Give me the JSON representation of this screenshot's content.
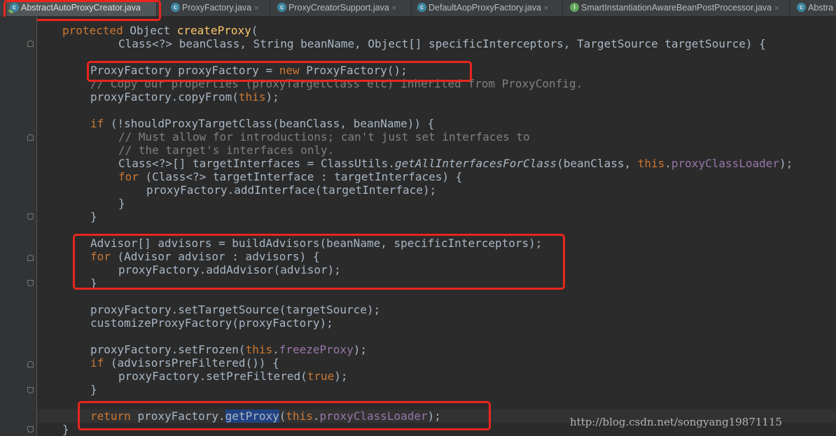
{
  "tabs": [
    {
      "label": "AbstractAutoProxyCreator.java",
      "icon": "class-icon",
      "type": "class",
      "active": true,
      "close": false
    },
    {
      "label": "ProxyFactory.java",
      "icon": "class-icon",
      "type": "class",
      "active": false,
      "close": true
    },
    {
      "label": "ProxyCreatorSupport.java",
      "icon": "class-icon",
      "type": "class",
      "active": false,
      "close": true
    },
    {
      "label": "DefaultAopProxyFactory.java",
      "icon": "class-icon",
      "type": "class",
      "active": false,
      "close": true
    },
    {
      "label": "SmartInstantiationAwareBeanPostProcessor.java",
      "icon": "interface-icon",
      "type": "interface",
      "active": false,
      "close": true
    },
    {
      "label": "Abstra",
      "icon": "class-icon",
      "type": "class",
      "active": false,
      "close": false
    }
  ],
  "tab_close_glyph": "×",
  "code": {
    "l1": {
      "kw": "protected ",
      "plain": "Object ",
      "fn": "createProxy",
      "rest": "("
    },
    "l2": {
      "text": "Class<?> beanClass, String beanName, Object[] specificInterceptors, TargetSource targetSource) {"
    },
    "l4": {
      "a": "ProxyFactory proxyFactory = ",
      "kw": "new ",
      "b": "ProxyFactory();"
    },
    "l5": {
      "text": "// Copy our properties (proxyTargetClass etc) inherited from ProxyConfig."
    },
    "l6": {
      "a": "proxyFactory.copyFrom(",
      "kw": "this",
      "b": ");"
    },
    "l8": {
      "kw": "if ",
      "text": "(!shouldProxyTargetClass(beanClass, beanName)) {"
    },
    "l9": {
      "text": "// Must allow for introductions; can't just set interfaces to"
    },
    "l10": {
      "text": "// the target's interfaces only."
    },
    "l11": {
      "a": "Class<?>[] targetInterfaces = ClassUtils.",
      "it": "getAllInterfacesForClass",
      "b": "(beanClass, ",
      "kw": "this",
      "c": ".",
      "fld": "proxyClassLoader",
      "d": ");"
    },
    "l12": {
      "kw": "for ",
      "text": "(Class<?> targetInterface : targetInterfaces) {"
    },
    "l13": {
      "text": "proxyFactory.addInterface(targetInterface);"
    },
    "l14": {
      "text": "}"
    },
    "l15": {
      "text": "}"
    },
    "l17": {
      "text": "Advisor[] advisors = buildAdvisors(beanName, specificInterceptors);"
    },
    "l18": {
      "kw": "for ",
      "text": "(Advisor advisor : advisors) {"
    },
    "l19": {
      "text": "proxyFactory.addAdvisor(advisor);"
    },
    "l20": {
      "text": "}"
    },
    "l22": {
      "text": "proxyFactory.setTargetSource(targetSource);"
    },
    "l23": {
      "text": "customizeProxyFactory(proxyFactory);"
    },
    "l25": {
      "a": "proxyFactory.setFrozen(",
      "kw": "this",
      "b": ".",
      "fld": "freezeProxy",
      "c": ");"
    },
    "l26": {
      "kw": "if ",
      "text": "(advisorsPreFiltered()) {"
    },
    "l27": {
      "a": "proxyFactory.setPreFiltered(",
      "kw": "true",
      "b": ");"
    },
    "l28": {
      "text": "}"
    },
    "l30": {
      "kw": "return ",
      "a": "proxyFactory.",
      "hl": "getProxy",
      "b": "(",
      "kw2": "this",
      "c": ".",
      "fld": "proxyClassLoader",
      "d": ");"
    },
    "l31": {
      "text": "}"
    }
  },
  "watermark": "http://blog.csdn.net/songyang19871115",
  "colors": {
    "annotation": "#e8261e",
    "keyword": "#cc7832",
    "method": "#ffc66d",
    "field": "#9876aa",
    "comment": "#808080",
    "text": "#a9b7c6",
    "background": "#2b2b2b"
  }
}
